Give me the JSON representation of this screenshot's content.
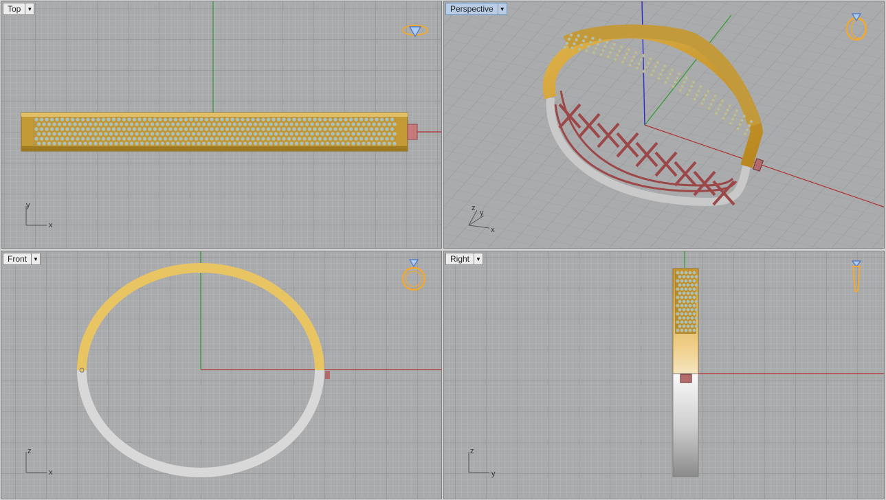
{
  "viewports": {
    "top": {
      "label": "Top",
      "axis_1": "y",
      "axis_2": "x"
    },
    "perspective": {
      "label": "Perspective",
      "axis_1": "z",
      "axis_2": "y",
      "axis_3": "x"
    },
    "front": {
      "label": "Front",
      "axis_1": "z",
      "axis_2": "x"
    },
    "right": {
      "label": "Right",
      "axis_1": "z",
      "axis_2": "y"
    }
  },
  "colors": {
    "gold": "#d9a93a",
    "silver": "#d6d6d6",
    "hinge": "#b36a6a",
    "x_axis": "#b03030",
    "y_axis": "#2e9a2e",
    "z_axis": "#2a2ad0",
    "icon": "#f0a830"
  }
}
